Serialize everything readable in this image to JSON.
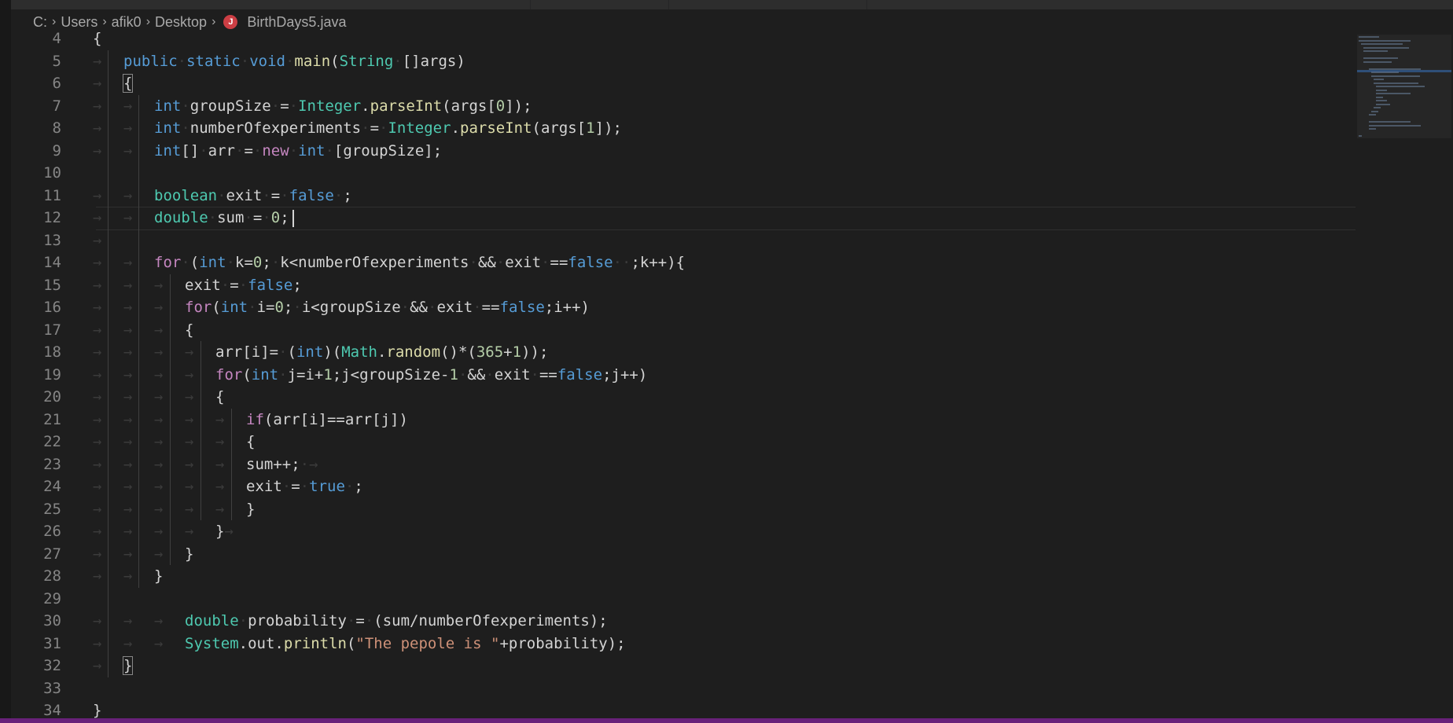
{
  "breadcrumb": {
    "items": [
      "C:",
      "Users",
      "afik0",
      "Desktop"
    ],
    "file_icon": "java-file-icon",
    "file_icon_glyph": "J",
    "file_name": "BirthDays5.java"
  },
  "editor": {
    "lines": [
      {
        "n": "4",
        "indent": 0,
        "tokens": [
          [
            "p",
            "{"
          ]
        ]
      },
      {
        "n": "5",
        "indent": 1,
        "tokens": [
          [
            "kw",
            "public"
          ],
          [
            "ws",
            "·"
          ],
          [
            "kw",
            "static"
          ],
          [
            "ws",
            "·"
          ],
          [
            "kw",
            "void"
          ],
          [
            "ws",
            "·"
          ],
          [
            "fn",
            "main"
          ],
          [
            "p",
            "("
          ],
          [
            "ty",
            "String"
          ],
          [
            "ws",
            "·"
          ],
          [
            "p",
            "[]args)"
          ]
        ]
      },
      {
        "n": "6",
        "indent": 1,
        "tokens": [
          [
            "box",
            "{"
          ]
        ]
      },
      {
        "n": "7",
        "indent": 2,
        "tokens": [
          [
            "kw",
            "int"
          ],
          [
            "ws",
            "·"
          ],
          [
            "p",
            "groupSize"
          ],
          [
            "ws",
            "·"
          ],
          [
            "p",
            "="
          ],
          [
            "ws",
            "·"
          ],
          [
            "ty",
            "Integer"
          ],
          [
            "p",
            "."
          ],
          [
            "fn",
            "parseInt"
          ],
          [
            "p",
            "(args["
          ],
          [
            "num",
            "0"
          ],
          [
            "p",
            "]);"
          ]
        ]
      },
      {
        "n": "8",
        "indent": 2,
        "tokens": [
          [
            "kw",
            "int"
          ],
          [
            "ws",
            "·"
          ],
          [
            "p",
            "numberOfexperiments"
          ],
          [
            "ws",
            "·"
          ],
          [
            "p",
            "="
          ],
          [
            "ws",
            "·"
          ],
          [
            "ty",
            "Integer"
          ],
          [
            "p",
            "."
          ],
          [
            "fn",
            "parseInt"
          ],
          [
            "p",
            "(args["
          ],
          [
            "num",
            "1"
          ],
          [
            "p",
            "]);"
          ]
        ]
      },
      {
        "n": "9",
        "indent": 2,
        "tokens": [
          [
            "kw",
            "int"
          ],
          [
            "p",
            "[]"
          ],
          [
            "ws",
            "·"
          ],
          [
            "p",
            "arr"
          ],
          [
            "ws",
            "·"
          ],
          [
            "p",
            "="
          ],
          [
            "ws",
            "·"
          ],
          [
            "ctl",
            "new"
          ],
          [
            "ws",
            "·"
          ],
          [
            "kw",
            "int"
          ],
          [
            "ws",
            "·"
          ],
          [
            "p",
            "[groupSize];"
          ]
        ]
      },
      {
        "n": "10",
        "indent": 0,
        "tokens": []
      },
      {
        "n": "11",
        "indent": 2,
        "tokens": [
          [
            "ty",
            "boolean"
          ],
          [
            "ws",
            "·"
          ],
          [
            "p",
            "exit"
          ],
          [
            "ws",
            "·"
          ],
          [
            "p",
            "="
          ],
          [
            "ws",
            "·"
          ],
          [
            "kw",
            "false"
          ],
          [
            "ws",
            "·"
          ],
          [
            "p",
            ";"
          ]
        ]
      },
      {
        "n": "12",
        "indent": 2,
        "tokens": [
          [
            "ty",
            "double"
          ],
          [
            "ws",
            "·"
          ],
          [
            "p",
            "sum"
          ],
          [
            "ws",
            "·"
          ],
          [
            "p",
            "="
          ],
          [
            "ws",
            "·"
          ],
          [
            "num",
            "0"
          ],
          [
            "p",
            ";"
          ],
          [
            "caret",
            ""
          ]
        ]
      },
      {
        "n": "13",
        "indent": 1,
        "tokens": []
      },
      {
        "n": "14",
        "indent": 2,
        "tokens": [
          [
            "ctl",
            "for"
          ],
          [
            "ws",
            "·"
          ],
          [
            "p",
            "("
          ],
          [
            "kw",
            "int"
          ],
          [
            "ws",
            "·"
          ],
          [
            "p",
            "k="
          ],
          [
            "num",
            "0"
          ],
          [
            "p",
            ";"
          ],
          [
            "ws",
            "·"
          ],
          [
            "p",
            "k<numberOfexperiments"
          ],
          [
            "ws",
            "·"
          ],
          [
            "p",
            "&&"
          ],
          [
            "ws",
            "·"
          ],
          [
            "p",
            "exit"
          ],
          [
            "ws",
            "·"
          ],
          [
            "p",
            "=="
          ],
          [
            "kw",
            "false"
          ],
          [
            "ws",
            "··"
          ],
          [
            "p",
            ";k++){"
          ]
        ]
      },
      {
        "n": "15",
        "indent": 3,
        "tokens": [
          [
            "p",
            "exit"
          ],
          [
            "ws",
            "·"
          ],
          [
            "p",
            "="
          ],
          [
            "ws",
            "·"
          ],
          [
            "kw",
            "false"
          ],
          [
            "p",
            ";"
          ]
        ]
      },
      {
        "n": "16",
        "indent": 3,
        "tokens": [
          [
            "ctl",
            "for"
          ],
          [
            "p",
            "("
          ],
          [
            "kw",
            "int"
          ],
          [
            "ws",
            "·"
          ],
          [
            "p",
            "i="
          ],
          [
            "num",
            "0"
          ],
          [
            "p",
            ";"
          ],
          [
            "ws",
            "·"
          ],
          [
            "p",
            "i<groupSize"
          ],
          [
            "ws",
            "·"
          ],
          [
            "p",
            "&&"
          ],
          [
            "ws",
            "·"
          ],
          [
            "p",
            "exit"
          ],
          [
            "ws",
            "·"
          ],
          [
            "p",
            "=="
          ],
          [
            "kw",
            "false"
          ],
          [
            "p",
            ";i++)"
          ]
        ]
      },
      {
        "n": "17",
        "indent": 3,
        "tokens": [
          [
            "p",
            "{"
          ]
        ]
      },
      {
        "n": "18",
        "indent": 4,
        "tokens": [
          [
            "p",
            "arr[i]="
          ],
          [
            "ws",
            "·"
          ],
          [
            "p",
            "("
          ],
          [
            "kw",
            "int"
          ],
          [
            "p",
            ")("
          ],
          [
            "ty",
            "Math"
          ],
          [
            "p",
            "."
          ],
          [
            "fn",
            "random"
          ],
          [
            "p",
            "()*("
          ],
          [
            "num",
            "365"
          ],
          [
            "p",
            "+"
          ],
          [
            "num",
            "1"
          ],
          [
            "p",
            "));"
          ]
        ]
      },
      {
        "n": "19",
        "indent": 4,
        "tokens": [
          [
            "ctl",
            "for"
          ],
          [
            "p",
            "("
          ],
          [
            "kw",
            "int"
          ],
          [
            "ws",
            "·"
          ],
          [
            "p",
            "j=i+"
          ],
          [
            "num",
            "1"
          ],
          [
            "p",
            ";j<groupSize-"
          ],
          [
            "num",
            "1"
          ],
          [
            "ws",
            "·"
          ],
          [
            "p",
            "&&"
          ],
          [
            "ws",
            "·"
          ],
          [
            "p",
            "exit"
          ],
          [
            "ws",
            "·"
          ],
          [
            "p",
            "=="
          ],
          [
            "kw",
            "false"
          ],
          [
            "p",
            ";j++)"
          ]
        ]
      },
      {
        "n": "20",
        "indent": 4,
        "tokens": [
          [
            "p",
            "{"
          ]
        ]
      },
      {
        "n": "21",
        "indent": 5,
        "tokens": [
          [
            "ctl",
            "if"
          ],
          [
            "p",
            "(arr[i]==arr[j])"
          ]
        ]
      },
      {
        "n": "22",
        "indent": 5,
        "tokens": [
          [
            "p",
            "{"
          ]
        ]
      },
      {
        "n": "23",
        "indent": 5,
        "tokens": [
          [
            "p",
            "sum++;"
          ],
          [
            "ws",
            "·→"
          ]
        ]
      },
      {
        "n": "24",
        "indent": 5,
        "tokens": [
          [
            "p",
            "exit"
          ],
          [
            "ws",
            "·"
          ],
          [
            "p",
            "="
          ],
          [
            "ws",
            "·"
          ],
          [
            "kw",
            "true"
          ],
          [
            "ws",
            "·"
          ],
          [
            "p",
            ";"
          ]
        ]
      },
      {
        "n": "25",
        "indent": 5,
        "tokens": [
          [
            "p",
            "}"
          ]
        ]
      },
      {
        "n": "26",
        "indent": 4,
        "tokens": [
          [
            "p",
            "}"
          ],
          [
            "ws",
            "→"
          ]
        ]
      },
      {
        "n": "27",
        "indent": 3,
        "tokens": [
          [
            "p",
            "}"
          ]
        ]
      },
      {
        "n": "28",
        "indent": 2,
        "tokens": [
          [
            "p",
            "}"
          ]
        ]
      },
      {
        "n": "29",
        "indent": 0,
        "tokens": []
      },
      {
        "n": "30",
        "indent": 3,
        "tokens": [
          [
            "ty",
            "double"
          ],
          [
            "ws",
            "·"
          ],
          [
            "p",
            "probability"
          ],
          [
            "ws",
            "·"
          ],
          [
            "p",
            "="
          ],
          [
            "ws",
            "·"
          ],
          [
            "p",
            "(sum/numberOfexperiments);"
          ]
        ]
      },
      {
        "n": "31",
        "indent": 3,
        "tokens": [
          [
            "ty",
            "System"
          ],
          [
            "p",
            "."
          ],
          [
            "p",
            "out"
          ],
          [
            "p",
            "."
          ],
          [
            "fn",
            "println"
          ],
          [
            "p",
            "("
          ],
          [
            "str",
            "\"The pepole is \""
          ],
          [
            "p",
            "+probability);"
          ]
        ]
      },
      {
        "n": "32",
        "indent": 1,
        "tokens": [
          [
            "box",
            "}"
          ]
        ]
      },
      {
        "n": "33",
        "indent": 0,
        "tokens": []
      },
      {
        "n": "34",
        "indent": 0,
        "tokens": [
          [
            "p",
            "}"
          ]
        ]
      }
    ]
  },
  "colors": {
    "background": "#1e1e1e",
    "keyword": "#569cd6",
    "control": "#c586c0",
    "type": "#4ec9b0",
    "function": "#dcdcaa",
    "number": "#b5cea8",
    "string": "#ce9178",
    "status_bar": "#68217a"
  }
}
